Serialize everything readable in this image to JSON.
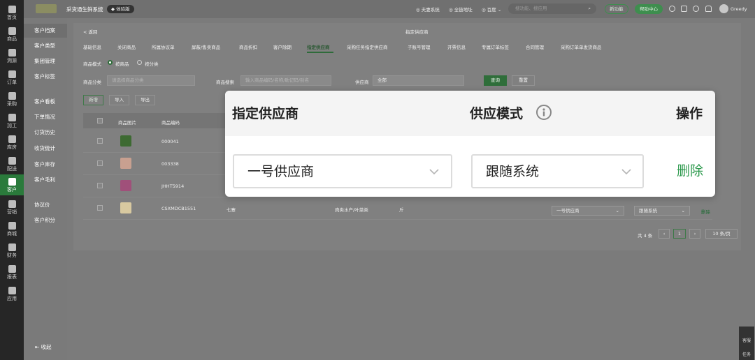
{
  "rail": [
    {
      "label": "首页",
      "icon": "home-icon"
    },
    {
      "label": "商品",
      "icon": "goods-icon"
    },
    {
      "label": "溯源",
      "icon": "trace-icon"
    },
    {
      "label": "订单",
      "icon": "order-icon"
    },
    {
      "label": "采购",
      "icon": "purchase-icon"
    },
    {
      "label": "加工",
      "icon": "process-icon"
    },
    {
      "label": "库房",
      "icon": "warehouse-icon"
    },
    {
      "label": "配送",
      "icon": "delivery-icon"
    },
    {
      "label": "客户",
      "icon": "customer-icon"
    },
    {
      "label": "营销",
      "icon": "marketing-icon"
    },
    {
      "label": "商城",
      "icon": "mall-icon"
    },
    {
      "label": "财务",
      "icon": "finance-icon"
    },
    {
      "label": "报表",
      "icon": "report-icon"
    },
    {
      "label": "应用",
      "icon": "apps-icon"
    }
  ],
  "subnav": {
    "items": [
      "客户档案",
      "客户类型",
      "集团管理",
      "客户标签",
      "客户看板",
      "下单情况",
      "订货历史",
      "收货统计",
      "客户库存",
      "客户毛利",
      "协议价",
      "客户积分"
    ],
    "collapse_label": "收起"
  },
  "header": {
    "system_name": "采货通生鲜系统",
    "env_badge": "体验版",
    "links": [
      "夫妻系统",
      "全链地址",
      "百度"
    ],
    "search_placeholder": "搜功能、搜应用",
    "new_feature": "新功能",
    "help_center": "帮助中心",
    "username": "Greedy"
  },
  "page": {
    "back": "< 返回",
    "title": "指定供应商",
    "tabs": [
      "基础信息",
      "关闭商品",
      "所属协议单",
      "屏蔽/售卖商品",
      "商品折扣",
      "客户除期",
      "指定供应商",
      "采购任务指定供应商",
      "子账号管理",
      "开票信息",
      "专属订单标签",
      "合同管理",
      "采购订单单发货商品"
    ],
    "active_tab_index": 6
  },
  "filters": {
    "mode_label": "商品模式",
    "mode_options": [
      "按商品",
      "按分类"
    ],
    "category_label": "商品分类",
    "category_placeholder": "请选择商品分类",
    "search_label": "商品搜索",
    "search_placeholder": "输入商品编码/名称/助记码/别名",
    "supplier_label": "供应商",
    "supplier_value": "全部",
    "query": "查询",
    "reset": "重置"
  },
  "actions": {
    "add": "新增",
    "import": "导入",
    "export": "导出"
  },
  "table": {
    "headers": [
      "商品图片",
      "商品编码"
    ],
    "rows": [
      {
        "code": "000041",
        "name": "",
        "category": "",
        "unit": "",
        "thumb_color": "#3d6a32"
      },
      {
        "code": "003338",
        "name": "",
        "category": "",
        "unit": "",
        "thumb_color": "#c8a090"
      },
      {
        "code": "JHHT5914",
        "name": "",
        "category": "",
        "unit": "",
        "thumb_color": "#a0507a"
      },
      {
        "code": "CSXMDCB1551",
        "name": "七寨",
        "category": "肉类水产/叶菜类",
        "unit": "斤",
        "thumb_color": "#d8c9a0"
      }
    ],
    "last_row_supplier": "一号供应商",
    "last_row_mode": "跟随系统",
    "last_row_action": "删除"
  },
  "pagination": {
    "total": "共 4 条",
    "current": "1",
    "page_size": "10 条/页"
  },
  "floating": {
    "service": "客服",
    "tasks": "任务"
  },
  "zoom": {
    "col_supplier": "指定供应商",
    "col_mode": "供应模式",
    "col_action": "操作",
    "supplier_value": "一号供应商",
    "mode_value": "跟随系统",
    "delete_label": "删除"
  },
  "colors": {
    "accent": "#2e9a4e",
    "rail_bg": "#262626",
    "rail_active": "#2a7a3b"
  }
}
